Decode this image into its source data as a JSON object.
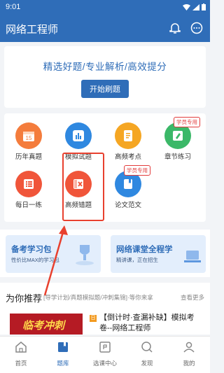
{
  "status": {
    "time": "9:01"
  },
  "appbar": {
    "title": "网络工程师"
  },
  "hero": {
    "slogan": "精选好题/专业解析/高效提分",
    "start_button": "开始刷题"
  },
  "grid": {
    "items": [
      {
        "label": "历年真题",
        "icon": "calendar-icon",
        "color": "#f47c3c"
      },
      {
        "label": "模拟试题",
        "icon": "chart-icon",
        "color": "#2f88e0"
      },
      {
        "label": "高频考点",
        "icon": "document-icon",
        "color": "#f5a623"
      },
      {
        "label": "章节练习",
        "icon": "edit-icon",
        "color": "#3bb868",
        "badge": "学员专用"
      },
      {
        "label": "每日一练",
        "icon": "list-icon",
        "color": "#f0553a"
      },
      {
        "label": "高频错题",
        "icon": "wrong-icon",
        "color": "#f0553a"
      },
      {
        "label": "论文范文",
        "icon": "book-icon",
        "color": "#2f88e0",
        "badge": "学员专用"
      }
    ]
  },
  "banners": [
    {
      "title": "备考学习包",
      "subtitle": "性价比MAX的学习包"
    },
    {
      "title": "网络课堂全程学",
      "subtitle": "精讲课，正在招生"
    }
  ],
  "recommend": {
    "heading": "为你推荐",
    "tags": "[导学计划/真题模拟题/冲刺集锦]·等你来拿",
    "more": "查看更多",
    "thumb_text": "临考冲刺",
    "tag": "日",
    "item_title": "【倒计时·查漏补缺】模拟考卷--网络工程师"
  },
  "tabbar": {
    "tabs": [
      {
        "label": "首页",
        "icon": "home-icon"
      },
      {
        "label": "题库",
        "icon": "bookmark-icon",
        "active": true
      },
      {
        "label": "选课中心",
        "icon": "course-icon"
      },
      {
        "label": "发现",
        "icon": "search-icon"
      },
      {
        "label": "我的",
        "icon": "user-icon"
      }
    ]
  }
}
